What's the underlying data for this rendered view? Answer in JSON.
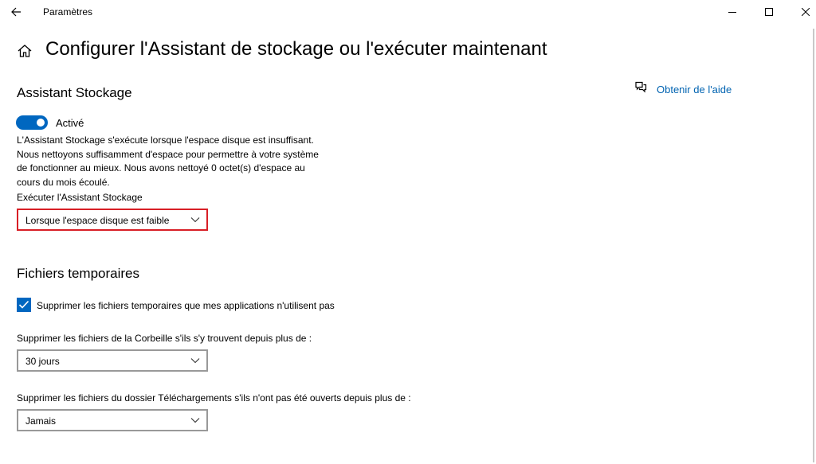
{
  "window": {
    "title": "Paramètres"
  },
  "icons": {
    "back": "back-arrow-icon",
    "home": "home-icon",
    "help": "chat-help-icon",
    "minimize": "minimize-icon",
    "maximize": "maximize-icon",
    "close": "close-icon"
  },
  "colors": {
    "accent": "#0067c0",
    "link": "#0063b1",
    "highlight": "#d81f26"
  },
  "page": {
    "title": "Configurer l'Assistant de stockage ou l'exécuter maintenant"
  },
  "help": {
    "label": "Obtenir de l'aide"
  },
  "storage_sense": {
    "heading": "Assistant Stockage",
    "toggle_label": "Activé",
    "toggle_on": true,
    "description": "L'Assistant Stockage s'exécute lorsque l'espace disque est insuffisant. Nous nettoyons suffisamment d'espace pour permettre à votre système de fonctionner au mieux. Nous avons nettoyé 0 octet(s) d'espace au cours du mois écoulé.",
    "run_label": "Exécuter l'Assistant Stockage",
    "run_value": "Lorsque l'espace disque est faible"
  },
  "temp_files": {
    "heading": "Fichiers temporaires",
    "checkbox_label": "Supprimer les fichiers temporaires que mes applications n'utilisent pas",
    "checkbox_checked": true,
    "recycle_label": "Supprimer les fichiers de la Corbeille s'ils s'y trouvent depuis plus de :",
    "recycle_value": "30 jours",
    "downloads_label": "Supprimer les fichiers du dossier Téléchargements s'ils n'ont pas été ouverts depuis plus de :",
    "downloads_value": "Jamais"
  }
}
